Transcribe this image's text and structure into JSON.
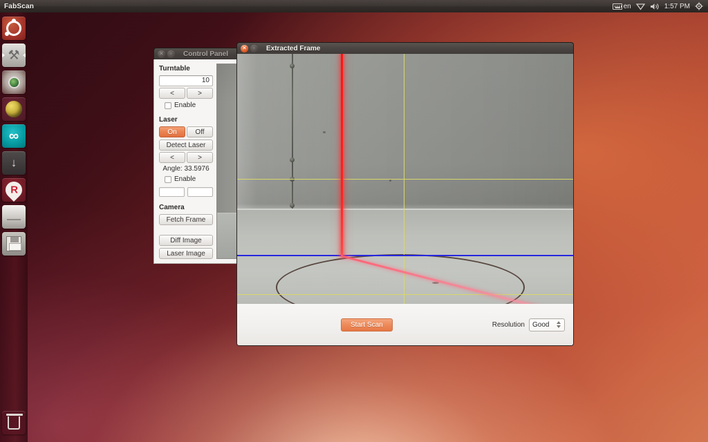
{
  "top_panel": {
    "app_name": "FabScan",
    "tray": {
      "keyboard_icon": "keyboard-icon",
      "keyboard_layout": "en",
      "network_icon": "network-icon",
      "volume_icon": "volume-icon",
      "clock": "1:57 PM",
      "session_icon": "gear-icon"
    }
  },
  "launcher": {
    "items": [
      {
        "name": "ubuntu-dash",
        "icon": "ubuntu-logo-icon"
      },
      {
        "name": "files",
        "icon": "files-icon"
      },
      {
        "name": "browser",
        "icon": "eye-icon"
      },
      {
        "name": "globe-app",
        "icon": "globe-icon"
      },
      {
        "name": "arduino-ide",
        "icon": "arduino-infinity-icon"
      },
      {
        "name": "updates",
        "icon": "download-icon"
      },
      {
        "name": "r-app",
        "icon": "r-droplet-icon"
      },
      {
        "name": "drive",
        "icon": "drive-icon"
      },
      {
        "name": "save-app",
        "icon": "floppy-disk-icon"
      }
    ],
    "trash": {
      "name": "trash",
      "icon": "trash-icon"
    }
  },
  "control_panel": {
    "title": "Control Panel",
    "window_buttons": {
      "close": "close-icon",
      "minimize": "minimize-icon"
    },
    "turntable": {
      "heading": "Turntable",
      "value": "10",
      "prev_label": "<",
      "next_label": ">",
      "enable_label": "Enable"
    },
    "laser": {
      "heading": "Laser",
      "on_label": "On",
      "off_label": "Off",
      "detect_label": "Detect Laser",
      "prev_label": "<",
      "next_label": ">",
      "angle_label": "Angle: 33.5976",
      "enable_label": "Enable",
      "field_left": "",
      "field_right": ""
    },
    "camera": {
      "heading": "Camera",
      "fetch_label": "Fetch Frame",
      "diff_label": "Diff Image",
      "laser_image_label": "Laser Image"
    }
  },
  "extracted_frame": {
    "title": "Extracted Frame",
    "window_buttons": {
      "close": "close-icon",
      "minimize": "minimize-icon"
    },
    "start_scan_label": "Start Scan",
    "resolution_label": "Resolution",
    "resolution_value": "Good"
  },
  "colors": {
    "accent_orange": "#ea8352",
    "laser_red": "#ff1414",
    "guide_yellow": "#d8d86a",
    "guide_blue": "#2626e0",
    "panel_dark": "#3c3633"
  }
}
